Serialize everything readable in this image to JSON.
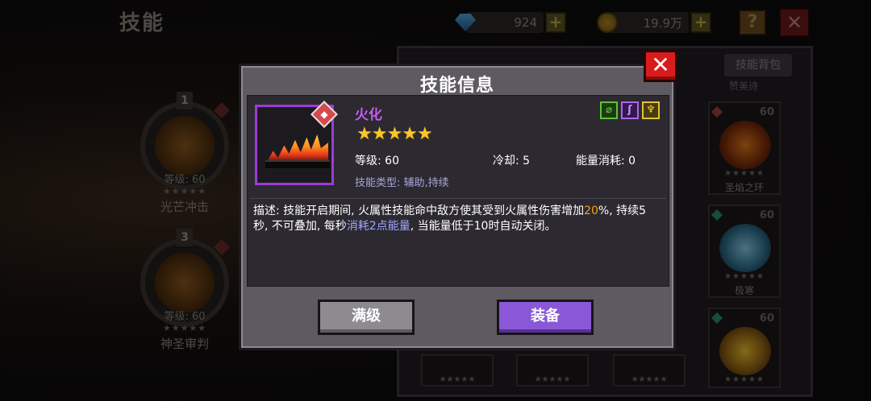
{
  "header": {
    "page_title": "技能",
    "gems": "924",
    "gold": "19.9万",
    "help_label": "?",
    "close_label": "✕"
  },
  "slots": [
    {
      "number": "1",
      "level": "等级: 60",
      "stars": "★★★★★",
      "name": "光芒冲击"
    },
    {
      "number": "3",
      "level": "等级: 60",
      "stars": "★★★★★",
      "name": "神圣审判"
    }
  ],
  "bag": {
    "tab_label": "技能背包",
    "partial_label": "赞美诗",
    "cards": [
      {
        "level": "60",
        "stars": "★★★★★",
        "name": "圣焰之环",
        "accent": "#e07a1a",
        "diamond": "#a04040"
      },
      {
        "level": "60",
        "stars": "★★★★★",
        "name": "极寒",
        "accent": "#6aa8c8",
        "diamond": "#2a8a6a"
      },
      {
        "level": "60",
        "stars": "★★★★★",
        "name": "",
        "accent": "#e0a820",
        "diamond": "#2a8a6a"
      }
    ],
    "bottom_stars": [
      "★★★★★",
      "★★★★★",
      "★★★★★",
      "★★★★★"
    ]
  },
  "modal": {
    "title": "技能信息",
    "close_label": "✕",
    "element_badge": "◆",
    "skill_name": "火化",
    "stars": "★★★★★",
    "level": "等级: 60",
    "cooldown": "冷却:  5",
    "energy": "能量消耗:  0",
    "skill_type": "技能类型: 辅助,持续",
    "tags": [
      {
        "symbol": "⌀",
        "color": "#5ec23a"
      },
      {
        "symbol": "ʃ",
        "color": "#a868e8"
      },
      {
        "symbol": "♆",
        "color": "#e0c23a"
      }
    ],
    "description": {
      "part1": "描述: 技能开启期间, 火属性技能命中敌方使其受到火属性伤害增加",
      "highlight1": "20",
      "part2": "%, 持续5秒, 不可叠加, 每秒",
      "highlight2": "消耗2点能量",
      "part3": ", 当能量低于10时自动关闭。"
    },
    "btn_max": "满级",
    "btn_equip": "装备"
  }
}
